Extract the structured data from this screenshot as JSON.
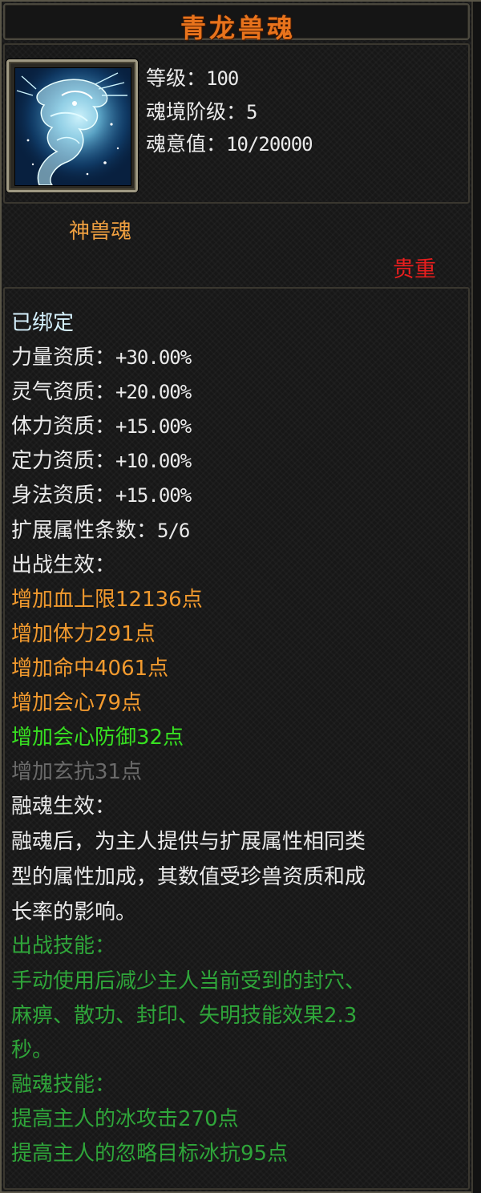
{
  "title": "青龙兽魂",
  "stats": {
    "level_label": "等级：",
    "level_value": "100",
    "soul_realm_label": "魂境阶级：",
    "soul_realm_value": "5",
    "soul_will_label": "魂意值：",
    "soul_will_value": "10/20000"
  },
  "type_label": "神兽魂",
  "rarity_label": "贵重",
  "bound_status": "已绑定",
  "aptitudes": [
    {
      "label": "力量资质：",
      "value": "+30.00%"
    },
    {
      "label": "灵气资质：",
      "value": "+20.00%"
    },
    {
      "label": "体力资质：",
      "value": "+15.00%"
    },
    {
      "label": "定力资质：",
      "value": "+10.00%"
    },
    {
      "label": "身法资质：",
      "value": "+15.00%"
    }
  ],
  "extended_attr": {
    "label": "扩展属性条数：",
    "value": "5/6"
  },
  "battle_effect_header": "出战生效：",
  "battle_effects": [
    "增加血上限12136点",
    "增加体力291点",
    "增加命中4061点",
    "增加会心79点",
    "增加会心防御32点",
    "增加玄抗31点"
  ],
  "fusion_effect_header": "融魂生效：",
  "fusion_effect_desc": [
    "融魂后，为主人提供与扩展属性相同类",
    "型的属性加成，其数值受珍兽资质和成",
    "长率的影响。"
  ],
  "battle_skill_header": "出战技能：",
  "battle_skill_desc": [
    "手动使用后减少主人当前受到的封穴、",
    "麻痹、散功、封印、失明技能效果2.3",
    "秒。"
  ],
  "fusion_skill_header": "融魂技能：",
  "fusion_skills": [
    "提高主人的冰攻击270点",
    "提高主人的忽略目标冰抗95点"
  ],
  "colors": {
    "title": "#e8731c",
    "type": "#f0a040",
    "rarity": "#e81e1e",
    "bonus_orange": "#f29a2e",
    "bonus_green": "#37e021",
    "bonus_inactive": "#6a6a6a",
    "skill_green": "#2fa63a"
  },
  "icon": "azure-dragon-soul-portrait"
}
